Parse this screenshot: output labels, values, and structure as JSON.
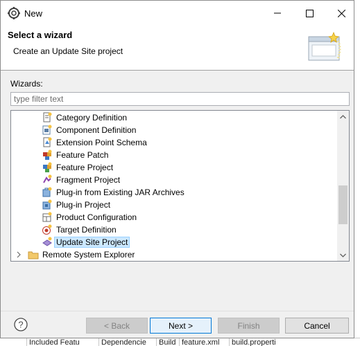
{
  "window": {
    "title": "New"
  },
  "header": {
    "title": "Select a wizard",
    "description": "Create an Update Site project"
  },
  "wizards_label": "Wizards:",
  "filter": {
    "placeholder": "type filter text",
    "value": ""
  },
  "tree": {
    "items": [
      {
        "label": "Category Definition",
        "icon": "category-icon",
        "level": 2
      },
      {
        "label": "Component Definition",
        "icon": "component-icon",
        "level": 2
      },
      {
        "label": "Extension Point Schema",
        "icon": "schema-icon",
        "level": 2
      },
      {
        "label": "Feature Patch",
        "icon": "feature-patch-icon",
        "level": 2
      },
      {
        "label": "Feature Project",
        "icon": "feature-icon",
        "level": 2
      },
      {
        "label": "Fragment Project",
        "icon": "fragment-icon",
        "level": 2
      },
      {
        "label": "Plug-in from Existing JAR Archives",
        "icon": "jar-plugin-icon",
        "level": 2
      },
      {
        "label": "Plug-in Project",
        "icon": "plugin-icon",
        "level": 2
      },
      {
        "label": "Product Configuration",
        "icon": "product-icon",
        "level": 2
      },
      {
        "label": "Target Definition",
        "icon": "target-icon",
        "level": 2
      },
      {
        "label": "Update Site Project",
        "icon": "update-site-icon",
        "level": 2,
        "selected": true
      },
      {
        "label": "Remote System Explorer",
        "icon": "folder-icon",
        "level": 1,
        "collapsed": true
      }
    ]
  },
  "buttons": {
    "back": "< Back",
    "next": "Next >",
    "finish": "Finish",
    "cancel": "Cancel"
  },
  "background": {
    "bottom_tabs": [
      "Included Featu",
      "Dependencie",
      "Build",
      "feature.xml",
      "build.properti"
    ]
  }
}
